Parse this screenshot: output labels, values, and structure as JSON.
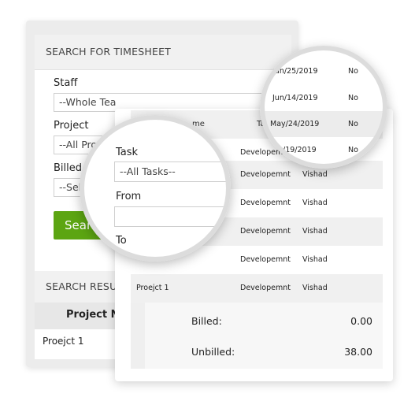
{
  "search": {
    "title": "SEARCH FOR TIMESHEET",
    "staff_label": "Staff",
    "staff_value": "--Whole Tea",
    "project_label": "Project",
    "project_value": "--All Proj",
    "billed_label": "Billed",
    "billed_value": "--Sele",
    "search_button": "Sear",
    "task_label": "Task",
    "task_value": "--All Tasks--",
    "from_label": "From",
    "from_value": "",
    "to_label": "To"
  },
  "results": {
    "title": "SEARCH RESU",
    "column_header": "Project Na",
    "first_row": "Proejct 1"
  },
  "table": {
    "header_cols": [
      "me",
      "Ta"
    ],
    "rows": [
      {
        "date": "Jun/25/2019",
        "billed": "No",
        "task": "",
        "staff": ""
      },
      {
        "date": "Jun/14/2019",
        "billed": "No",
        "task": "",
        "staff": ""
      },
      {
        "date": "May/24/2019",
        "billed": "No",
        "task": "",
        "staff": ""
      },
      {
        "date": "/19/2019",
        "billed": "No",
        "task": "Developemnt",
        "staff": ""
      },
      {
        "date": "",
        "billed": "",
        "task": "Developemnt",
        "staff": "Vishad"
      },
      {
        "date": "",
        "billed": "",
        "task": "Developemnt",
        "staff": "Vishad"
      },
      {
        "date": "",
        "billed": "",
        "task": "Developemnt",
        "staff": "Vishad"
      },
      {
        "date": "",
        "billed": "",
        "task": "Developemnt",
        "staff": "Vishad"
      },
      {
        "project": "Proejct 1",
        "task": "Developemnt",
        "staff": "Vishad"
      }
    ],
    "summary": {
      "billed_label": "Billed:",
      "billed_value": "0.00",
      "unbilled_label": "Unbilled:",
      "unbilled_value": "38.00"
    }
  },
  "colors": {
    "accent_green": "#5ca512",
    "header_bg": "#f1f1f1",
    "row_alt_bg": "#f0f0f0"
  }
}
